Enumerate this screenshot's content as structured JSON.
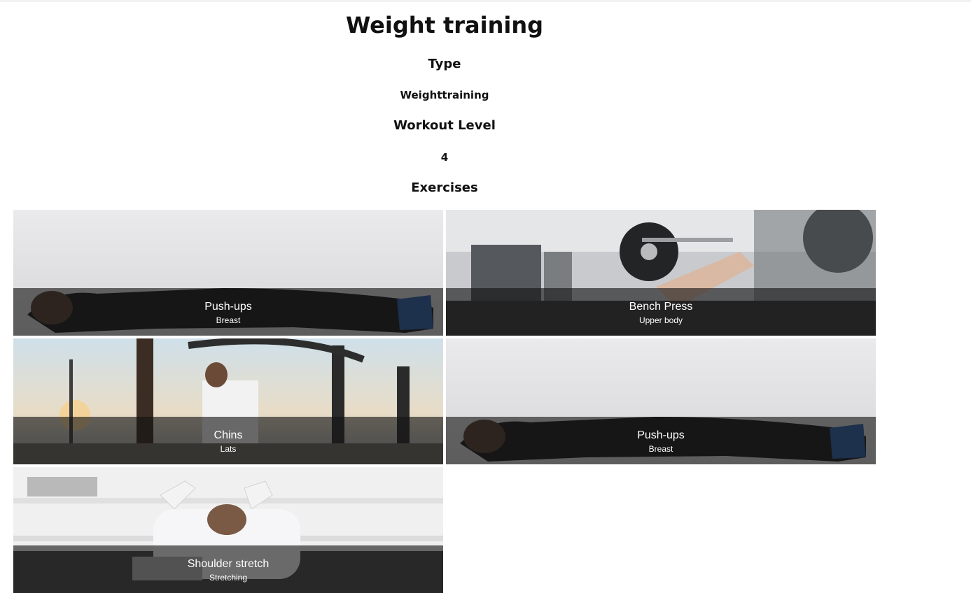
{
  "page": {
    "title": "Weight training",
    "type_heading": "Type",
    "type_value": "Weighttraining",
    "level_heading": "Workout Level",
    "level_value": "4",
    "exercises_heading": "Exercises"
  },
  "exercises": [
    {
      "name": "Push-ups",
      "category": "Breast"
    },
    {
      "name": "Bench Press",
      "category": "Upper body"
    },
    {
      "name": "Chins",
      "category": "Lats"
    },
    {
      "name": "Push-ups",
      "category": "Breast"
    },
    {
      "name": "Shoulder stretch",
      "category": "Stretching"
    }
  ]
}
